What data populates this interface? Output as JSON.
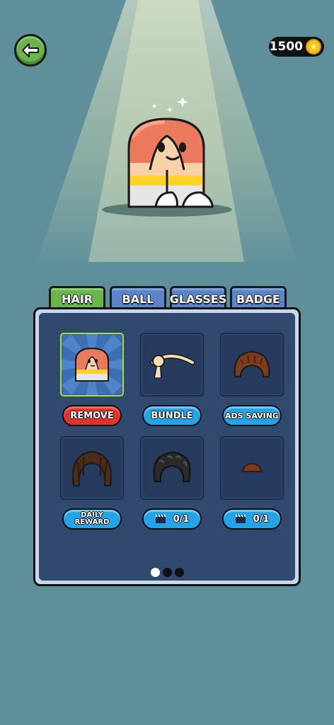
{
  "header": {
    "back_icon": "arrow-left-icon",
    "coins": "1500",
    "coin_icon": "star-coin-icon"
  },
  "tabs": [
    {
      "label": "HAIR",
      "active": true
    },
    {
      "label": "BALL",
      "active": false
    },
    {
      "label": "GLASSES",
      "active": false
    },
    {
      "label": "BADGE",
      "active": false
    }
  ],
  "items": [
    {
      "name": "default",
      "button": "REMOVE",
      "button_color": "#e0332b",
      "selected": true
    },
    {
      "name": "bun-hair",
      "button": "BUNDLE",
      "button_color": "#24a3e6",
      "selected": false
    },
    {
      "name": "messy-brown-hair",
      "button": "ADS SAVING",
      "button_color": "#24a3e6",
      "selected": false
    },
    {
      "name": "long-brown-hair",
      "button_line1": "DAILY",
      "button_line2": "REWARD",
      "button_color": "#24a3e6",
      "selected": false
    },
    {
      "name": "black-curly-hair",
      "button": "0/1",
      "button_icon": "video-clapper-icon",
      "button_color": "#24a3e6",
      "selected": false
    },
    {
      "name": "small-brown-hair",
      "button": "0/1",
      "button_icon": "video-clapper-icon",
      "button_color": "#24a3e6",
      "selected": false
    }
  ],
  "pagination": {
    "pages": 3,
    "current": 1
  },
  "colors": {
    "background": "#5f8f9b",
    "panel": "#31486f",
    "active_tab": "#6bb64b",
    "inactive_tab": "#5a86c9"
  }
}
